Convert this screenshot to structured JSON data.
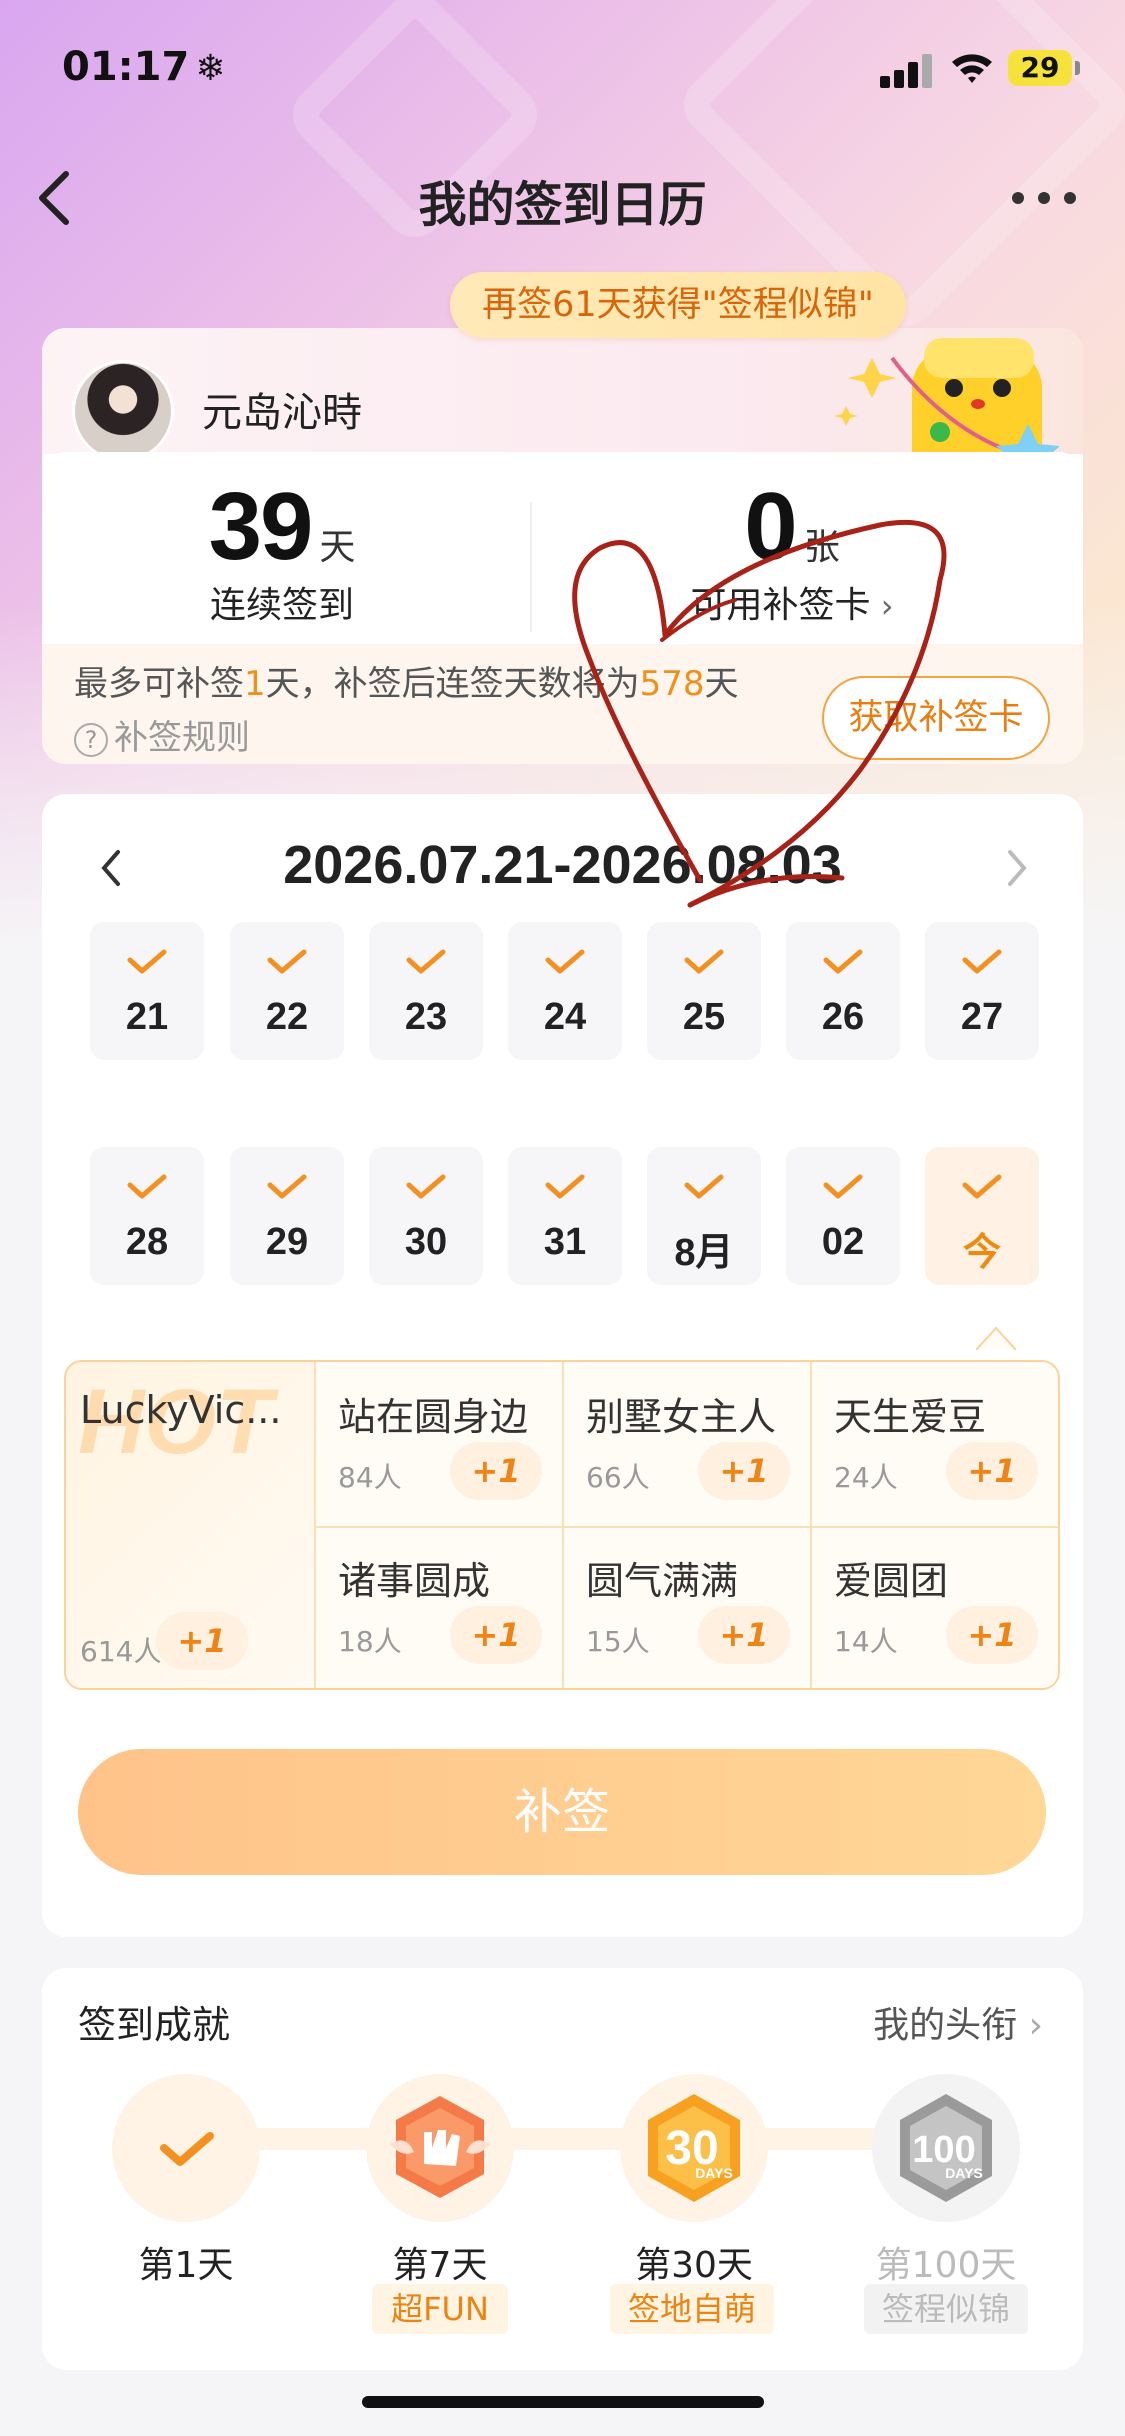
{
  "status_bar": {
    "time": "01:17",
    "weather_icon": "snowflake-icon",
    "battery": "29"
  },
  "nav": {
    "title": "我的签到日历"
  },
  "banner": {
    "text": "再签61天获得\"签程似锦\""
  },
  "user": {
    "name": "元岛沁時",
    "streak": {
      "value": "39",
      "unit": "天",
      "label": "连续签到"
    },
    "cards": {
      "value": "0",
      "unit": "张",
      "label": "可用补签卡"
    },
    "tip_prefix": "最多可补签",
    "tip_days": "1",
    "tip_mid": "天，补签后连签天数将为",
    "tip_total": "578",
    "tip_suffix": "天",
    "rule": "补签规则",
    "get_card_button": "获取补签卡"
  },
  "calendar": {
    "range": "2026.07.21-2026.08.03",
    "days": [
      {
        "label": "21",
        "checked": true
      },
      {
        "label": "22",
        "checked": true
      },
      {
        "label": "23",
        "checked": true
      },
      {
        "label": "24",
        "checked": true
      },
      {
        "label": "25",
        "checked": true
      },
      {
        "label": "26",
        "checked": true
      },
      {
        "label": "27",
        "checked": true
      },
      {
        "label": "28",
        "checked": true
      },
      {
        "label": "29",
        "checked": true
      },
      {
        "label": "30",
        "checked": true
      },
      {
        "label": "31",
        "checked": true
      },
      {
        "label": "8月",
        "checked": true
      },
      {
        "label": "02",
        "checked": true
      },
      {
        "label": "今",
        "checked": true,
        "today": true
      }
    ]
  },
  "titles": {
    "hot": "HOT",
    "items": [
      {
        "name": "LuckyVic...",
        "count": "614人",
        "plus": "+1"
      },
      {
        "name": "站在圆身边",
        "count": "84人",
        "plus": "+1"
      },
      {
        "name": "别墅女主人",
        "count": "66人",
        "plus": "+1"
      },
      {
        "name": "天生爱豆",
        "count": "24人",
        "plus": "+1"
      },
      {
        "name": "诸事圆成",
        "count": "18人",
        "plus": "+1"
      },
      {
        "name": "圆气满满",
        "count": "15人",
        "plus": "+1"
      },
      {
        "name": "爱圆团",
        "count": "14人",
        "plus": "+1"
      }
    ]
  },
  "makeup_button": "补签",
  "achievements": {
    "title": "签到成就",
    "link": "我的头衔",
    "badges": [
      {
        "label": "第1天",
        "tag": ""
      },
      {
        "label": "第7天",
        "tag": "超FUN"
      },
      {
        "label": "第30天",
        "tag": "签地自萌",
        "badge_text": "30",
        "badge_sub": "DAYS"
      },
      {
        "label": "第100天",
        "tag": "签程似锦",
        "badge_text": "100",
        "badge_sub": "DAYS"
      }
    ]
  },
  "colors": {
    "accent": "#f0901a",
    "scribble": "#a82218"
  }
}
